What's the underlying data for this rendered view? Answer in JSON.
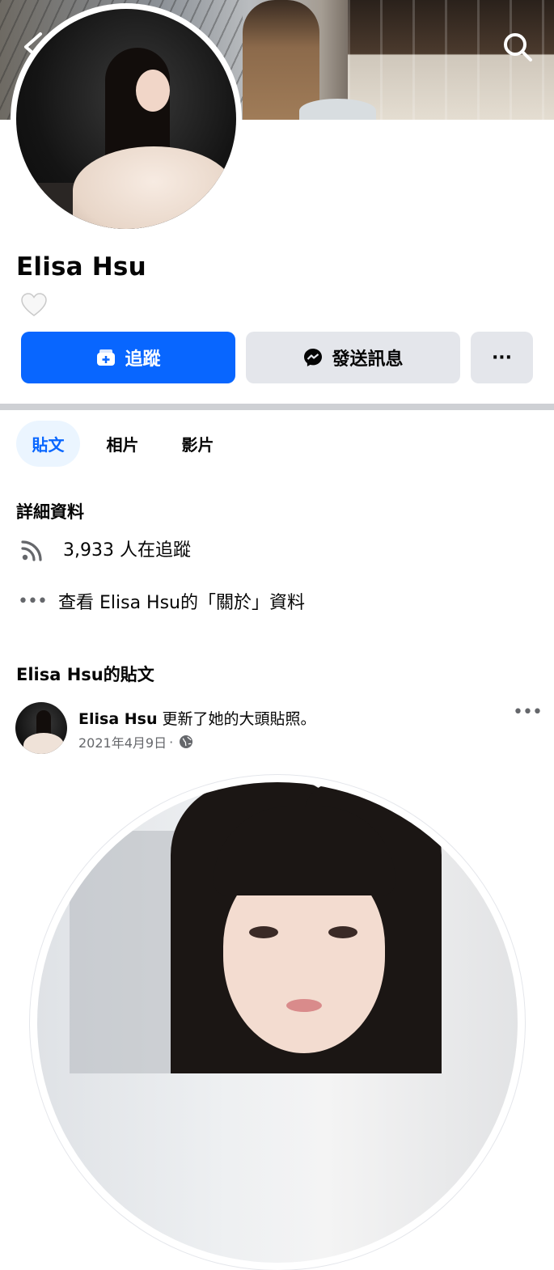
{
  "profile": {
    "name": "Elisa Hsu"
  },
  "actions": {
    "follow_label": "追蹤",
    "message_label": "發送訊息",
    "more_label": "···"
  },
  "tabs": [
    {
      "label": "貼文",
      "active": true
    },
    {
      "label": "相片",
      "active": false
    },
    {
      "label": "影片",
      "active": false
    }
  ],
  "details": {
    "title": "詳細資料",
    "followers_text": "3,933 人在追蹤",
    "about_text": "查看 Elisa Hsu的「關於」資料"
  },
  "posts_section": {
    "title": "Elisa Hsu的貼文"
  },
  "post": {
    "author": "Elisa Hsu",
    "action_text": "更新了她的大頭貼照。",
    "date": "2021年4月9日",
    "separator": "·"
  },
  "colors": {
    "brand_blue": "#0866ff",
    "button_gray": "#e4e6eb",
    "secondary_text": "#65676b"
  },
  "icons": [
    "back-icon",
    "search-icon",
    "heart-icon",
    "follow-icon",
    "messenger-icon",
    "rss-icon",
    "globe-icon"
  ]
}
